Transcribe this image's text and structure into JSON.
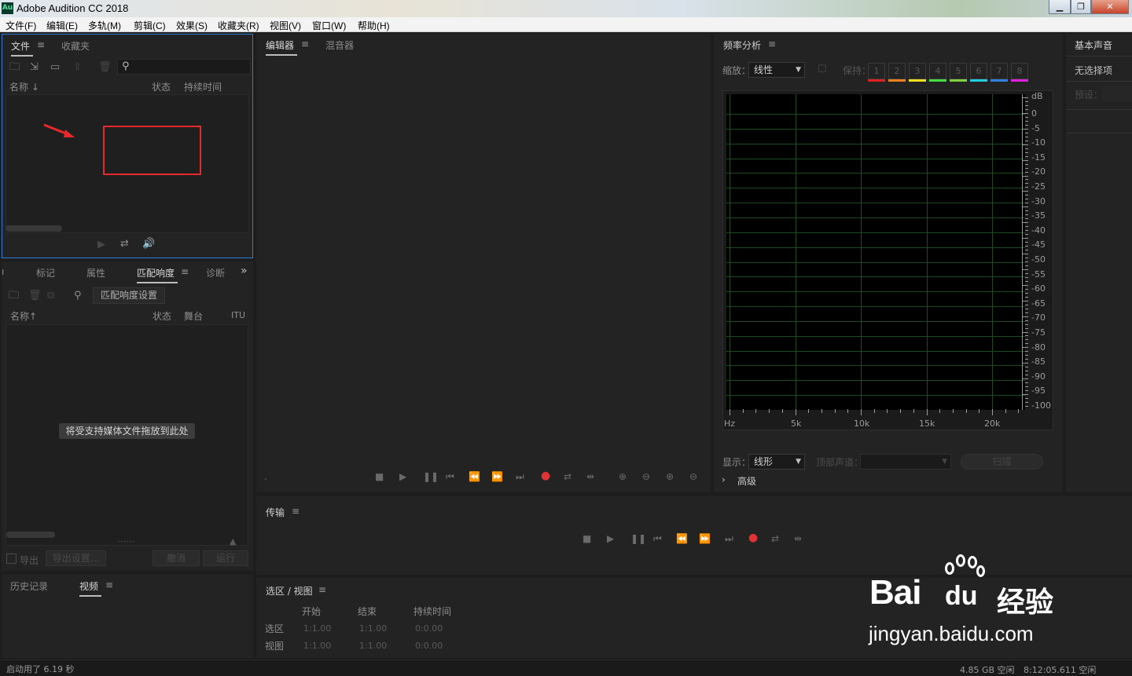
{
  "window": {
    "title": "Adobe Audition CC 2018",
    "app_icon": "Au",
    "controls": [
      "minimize-icon",
      "restore-icon",
      "close-icon"
    ]
  },
  "menu": [
    "文件(F)",
    "编辑(E)",
    "多轨(M)",
    "剪辑(C)",
    "效果(S)",
    "收藏夹(R)",
    "视图(V)",
    "窗口(W)",
    "帮助(H)"
  ],
  "files_panel": {
    "tabs": [
      "文件",
      "收藏夹"
    ],
    "columns": [
      "名称",
      "状态",
      "持续时间"
    ]
  },
  "loudness_panel": {
    "tabs": [
      "标记",
      "属性",
      "匹配响度",
      "诊断"
    ],
    "settings_button": "匹配响度设置",
    "columns": [
      "名称",
      "状态",
      "舞台",
      "ITU"
    ],
    "drop_hint": "将受支持媒体文件拖放到此处",
    "export_label": "导出",
    "export_settings": "导出设置...",
    "cancel": "撤消",
    "run": "运行"
  },
  "history_panel": {
    "tabs": [
      "历史记录",
      "视频"
    ]
  },
  "editor": {
    "tabs": [
      "编辑器",
      "混音器"
    ]
  },
  "transport_panel": {
    "title": "传输"
  },
  "selection_panel": {
    "title": "选区 / 视图",
    "columns": [
      "开始",
      "结束",
      "持续时间"
    ],
    "rows": [
      {
        "label": "选区",
        "start": "1:1.00",
        "end": "1:1.00",
        "duration": "0:0.00"
      },
      {
        "label": "视图",
        "start": "1:1.00",
        "end": "1:1.00",
        "duration": "0:0.00"
      }
    ]
  },
  "freq_panel": {
    "title": "频率分析",
    "zoom_label": "缩放：",
    "zoom_value": "线性",
    "hold_label": "保持：",
    "hold_slots": [
      "1",
      "2",
      "3",
      "4",
      "5",
      "6",
      "7",
      "8"
    ],
    "hold_colors": [
      "#e02020",
      "#f08020",
      "#f0e020",
      "#40e040",
      "#80d040",
      "#20d0e0",
      "#3080e0",
      "#e020e0"
    ],
    "db_labels": [
      "dB",
      "0",
      "-5",
      "-10",
      "-15",
      "-20",
      "-25",
      "-30",
      "-35",
      "-40",
      "-45",
      "-50",
      "-55",
      "-60",
      "-65",
      "-70",
      "-75",
      "-80",
      "-85",
      "-90",
      "-95",
      "-100"
    ],
    "hz_labels": [
      "Hz",
      "5k",
      "10k",
      "15k",
      "20k"
    ],
    "display_label": "显示：",
    "display_value": "线形",
    "channel_label": "顶部声道：",
    "scan": "扫描",
    "advanced": "高级"
  },
  "essential_sound": {
    "title": "基本声音",
    "no_selection": "无选择项",
    "preset_label": "预设："
  },
  "status": {
    "startup": "启动用了 6.19 秒",
    "disk": "4.85 GB 空闲",
    "time": "8:12:05.611 空闲"
  },
  "watermark": {
    "brand": "Bai",
    "brand2": "du",
    "brand_cn": "经验",
    "url": "jingyan.baidu.com"
  }
}
